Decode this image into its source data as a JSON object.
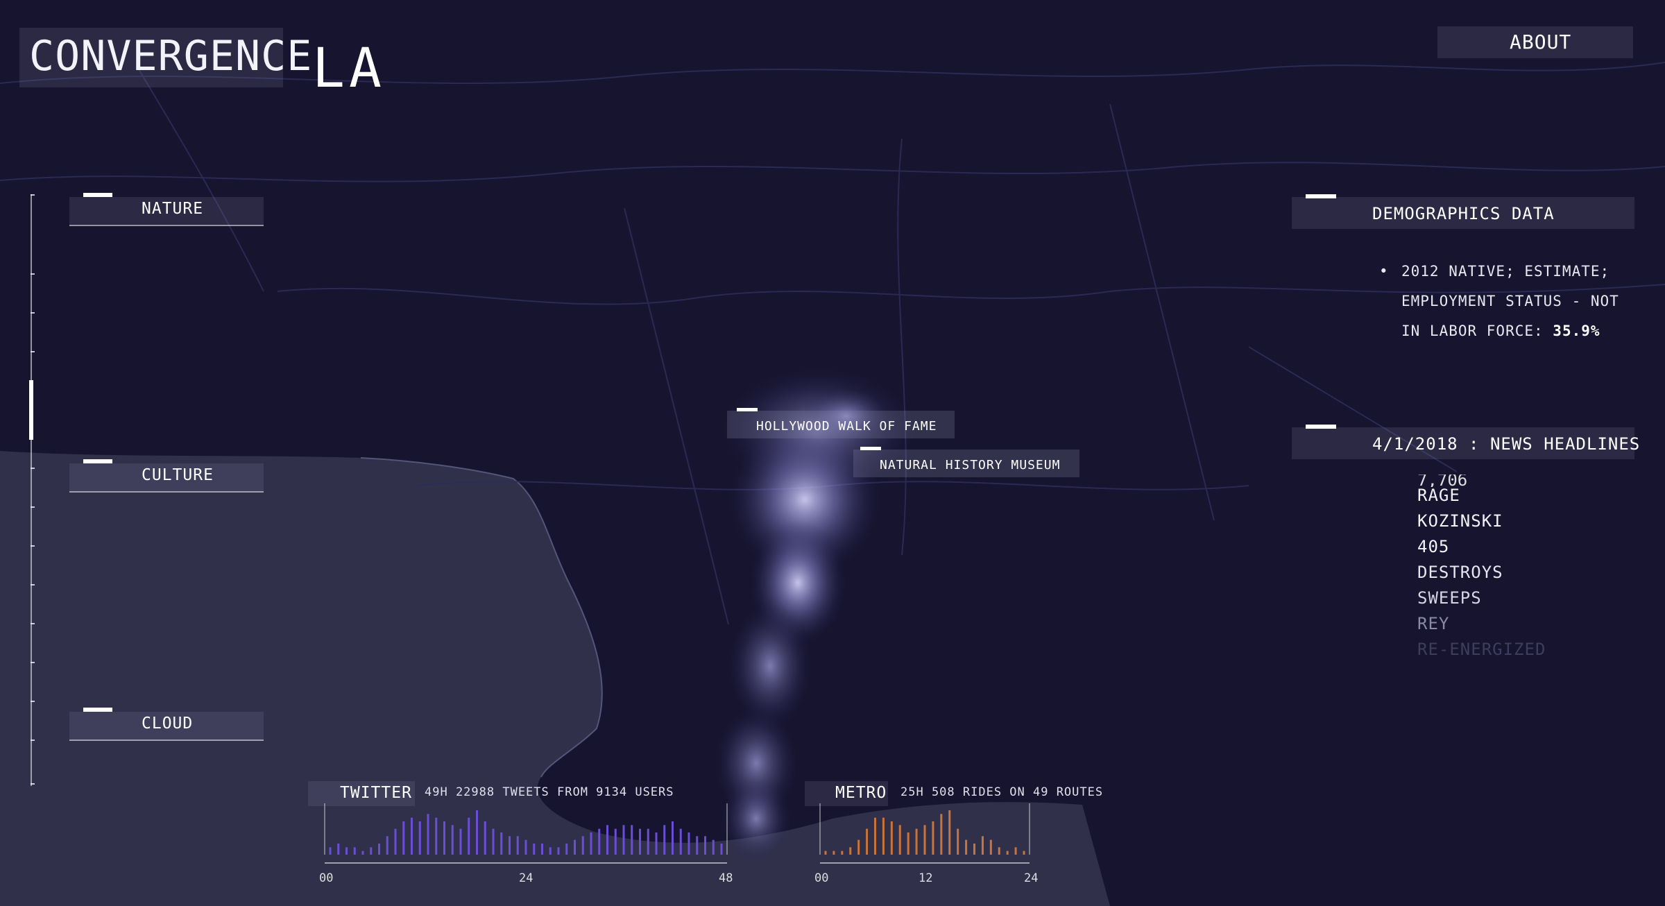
{
  "app": {
    "title_main": "CONVERGENCE",
    "title_city": "LA",
    "about_label": "ABOUT"
  },
  "categories": [
    {
      "label": "NATURE"
    },
    {
      "label": "CULTURE"
    },
    {
      "label": "CLOUD"
    }
  ],
  "demographics": {
    "heading": "DEMOGRAPHICS DATA",
    "line1": "2012 NATIVE; ESTIMATE;",
    "line2": "EMPLOYMENT STATUS - NOT",
    "line3_prefix": "IN LABOR FORCE: ",
    "line3_value": "35.9%"
  },
  "news": {
    "date": "4/1/2018",
    "separator": ":",
    "heading": "NEWS HEADLINES",
    "partial_item": "7,706",
    "items": [
      "RAGE",
      "KOZINSKI",
      "405",
      "DESTROYS",
      "SWEEPS",
      "REY",
      "RE-ENERGIZED"
    ]
  },
  "map_labels": {
    "hollywood": "HOLLYWOOD WALK OF FAME",
    "museum": "NATURAL HISTORY MUSEUM"
  },
  "twitter": {
    "title": "TWITTER",
    "summary": "49H 22988 TWEETS FROM 9134 USERS",
    "axis": [
      "00",
      "24",
      "48"
    ]
  },
  "metro": {
    "title": "METRO",
    "summary": "25H 508 RIDES ON 49 ROUTES",
    "axis": [
      "00",
      "12",
      "24"
    ]
  },
  "colors": {
    "background": "#16142e",
    "ocean": "#3a3a55",
    "twitter_bar": "#6a4ed6",
    "metro_bar": "#c8743a",
    "city_glow": "#b9b6e8"
  },
  "chart_data": [
    {
      "type": "bar",
      "title": "TWITTER",
      "subtitle": "49H 22988 TWEETS FROM 9134 USERS",
      "x_ticks": [
        "00",
        "24",
        "48"
      ],
      "values": [
        2,
        3,
        2,
        2,
        1,
        2,
        3,
        5,
        7,
        9,
        10,
        9,
        11,
        10,
        9,
        8,
        7,
        10,
        12,
        9,
        7,
        6,
        5,
        5,
        4,
        3,
        3,
        2,
        2,
        3,
        4,
        5,
        6,
        7,
        8,
        7,
        8,
        8,
        7,
        7,
        6,
        8,
        9,
        7,
        6,
        5,
        5,
        4,
        3
      ]
    },
    {
      "type": "bar",
      "title": "METRO",
      "subtitle": "25H 508 RIDES ON 49 ROUTES",
      "x_ticks": [
        "00",
        "12",
        "24"
      ],
      "values": [
        1,
        1,
        1,
        2,
        4,
        7,
        10,
        10,
        9,
        8,
        6,
        7,
        8,
        9,
        11,
        12,
        7,
        4,
        3,
        5,
        4,
        2,
        1,
        2,
        1
      ]
    }
  ]
}
